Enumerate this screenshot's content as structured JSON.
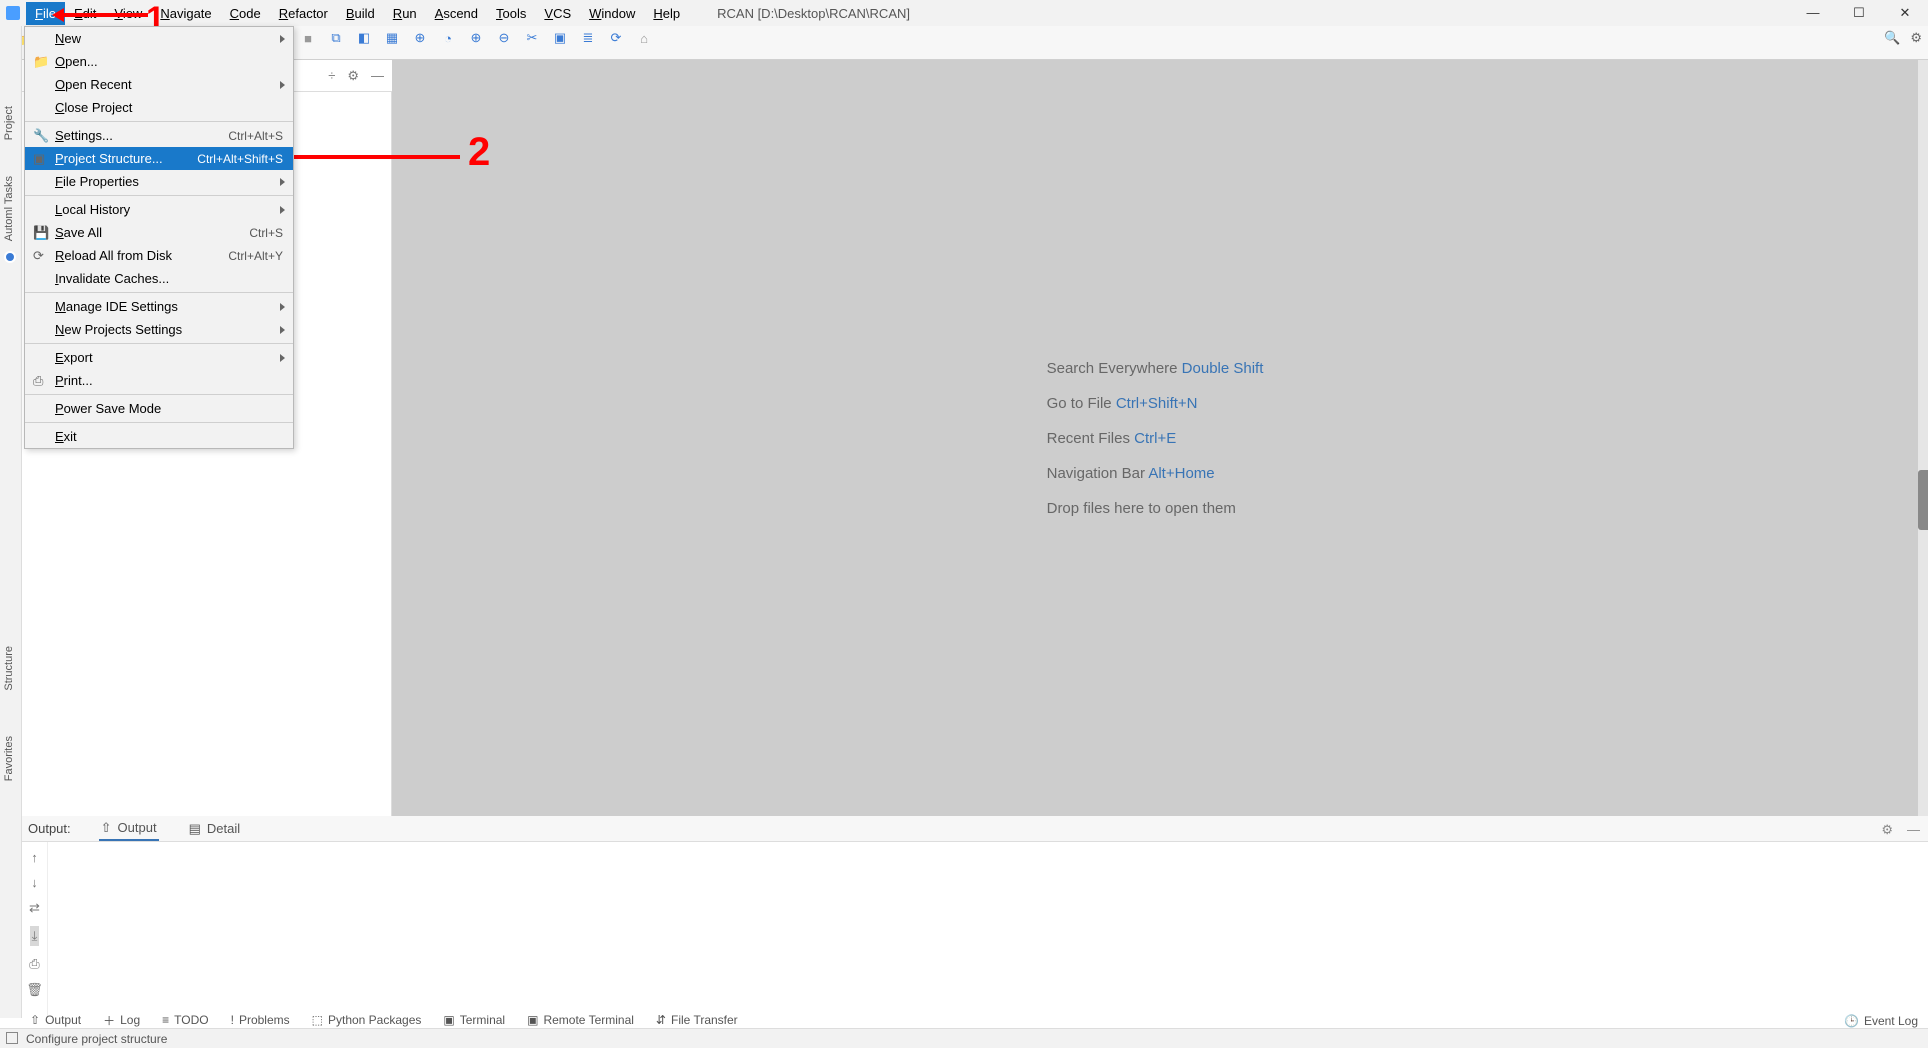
{
  "window": {
    "title": "RCAN [D:\\Desktop\\RCAN\\RCAN]",
    "min": "—",
    "max": "☐",
    "close": "✕"
  },
  "menu": {
    "items": [
      "File",
      "Edit",
      "View",
      "Navigate",
      "Code",
      "Refactor",
      "Build",
      "Run",
      "Ascend",
      "Tools",
      "VCS",
      "Window",
      "Help"
    ]
  },
  "file_menu": {
    "items": [
      {
        "label": "New",
        "sub": true
      },
      {
        "label": "Open...",
        "icon": "folder"
      },
      {
        "label": "Open Recent",
        "sub": true
      },
      {
        "label": "Close Project"
      },
      {
        "sep": true
      },
      {
        "label": "Settings...",
        "shortcut": "Ctrl+Alt+S",
        "icon": "wrench"
      },
      {
        "label": "Project Structure...",
        "shortcut": "Ctrl+Alt+Shift+S",
        "icon": "folder-gear",
        "selected": true
      },
      {
        "label": "File Properties",
        "sub": true
      },
      {
        "sep": true
      },
      {
        "label": "Local History",
        "sub": true
      },
      {
        "label": "Save All",
        "shortcut": "Ctrl+S",
        "icon": "save"
      },
      {
        "label": "Reload All from Disk",
        "shortcut": "Ctrl+Alt+Y",
        "icon": "reload"
      },
      {
        "label": "Invalidate Caches..."
      },
      {
        "sep": true
      },
      {
        "label": "Manage IDE Settings",
        "sub": true
      },
      {
        "label": "New Projects Settings",
        "sub": true
      },
      {
        "sep": true
      },
      {
        "label": "Export",
        "sub": true
      },
      {
        "label": "Print...",
        "icon": "print"
      },
      {
        "sep": true
      },
      {
        "label": "Power Save Mode"
      },
      {
        "sep": true
      },
      {
        "label": "Exit"
      }
    ]
  },
  "left_strip": {
    "project": "Project",
    "automl": "Automl Tasks",
    "structure": "Structure",
    "favorites": "Favorites"
  },
  "editor_hints": [
    {
      "text": "Search Everywhere ",
      "link": "Double Shift"
    },
    {
      "text": "Go to File ",
      "link": "Ctrl+Shift+N"
    },
    {
      "text": "Recent Files ",
      "link": "Ctrl+E"
    },
    {
      "text": "Navigation Bar ",
      "link": "Alt+Home"
    },
    {
      "text": "Drop files here to open them",
      "link": ""
    }
  ],
  "output": {
    "label": "Output:",
    "tab1": "Output",
    "tab2": "Detail"
  },
  "bottom_tabs": [
    "Output",
    "Log",
    "TODO",
    "Problems",
    "Python Packages",
    "Terminal",
    "Remote Terminal",
    "File Transfer"
  ],
  "bottom_right": "Event Log",
  "status": "Configure project structure",
  "annotations": {
    "one": "1",
    "two": "2"
  }
}
